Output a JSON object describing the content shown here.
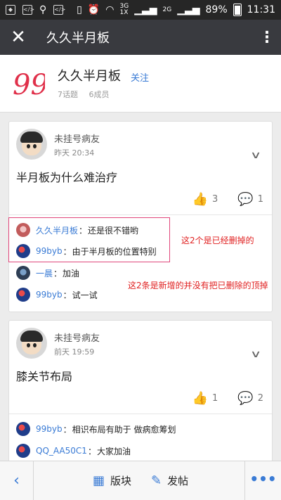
{
  "statusbar": {
    "network_3g": "3G",
    "network_1x": "1X",
    "network_2g": "2G",
    "battery": "89%",
    "time": "11:31"
  },
  "appbar": {
    "title": "久久半月板"
  },
  "board": {
    "name": "久久半月板",
    "follow": "关注",
    "topics": "7话题",
    "members": "6成员",
    "logo_text": "99",
    "logo_color": "#e0304a"
  },
  "posts": [
    {
      "author": "未挂号病友",
      "time": "昨天 20:34",
      "title": "半月板为什么难治疗",
      "likes": "3",
      "comments": "1",
      "replies": [
        {
          "name": "久久半月板",
          "text": "还是很不错哟"
        },
        {
          "name": "99byb",
          "text": "由于半月板的位置特别"
        },
        {
          "name": "一晨",
          "text": "加油"
        },
        {
          "name": "99byb",
          "text": "试一试"
        }
      ]
    },
    {
      "author": "未挂号病友",
      "time": "前天 19:59",
      "title": "膝关节布局",
      "likes": "1",
      "comments": "2",
      "replies": [
        {
          "name": "99byb",
          "text": "相识布局有助于 做病愈筹划"
        },
        {
          "name": "QQ_AA50C1",
          "text": "大家加油"
        }
      ]
    }
  ],
  "annotations": {
    "deleted_note": "这2个是已经删掉的",
    "new_note": "这2条是新增的并没有把已删除的顶掉"
  },
  "bottombar": {
    "board_label": "版块",
    "post_label": "发帖"
  },
  "accent": "#3a7bd5"
}
